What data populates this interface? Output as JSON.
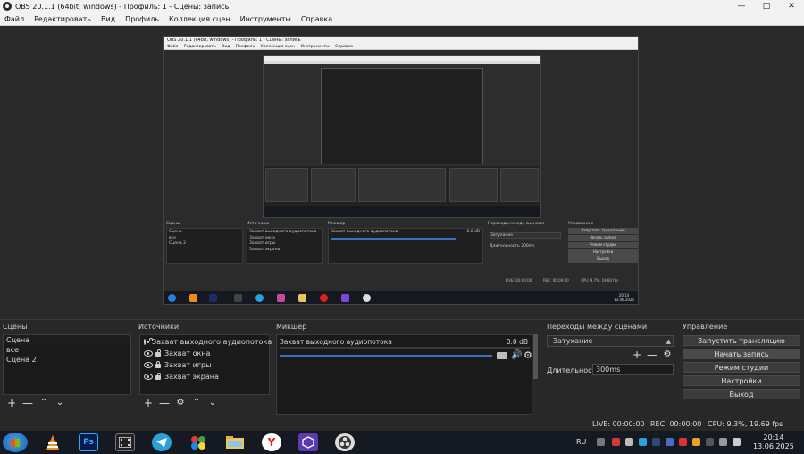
{
  "window": {
    "title": "OBS 20.1.1 (64bit, windows) - Профиль: 1 - Сцены: запись"
  },
  "menu": [
    "Файл",
    "Редактировать",
    "Вид",
    "Профиль",
    "Коллекция сцен",
    "Инструменты",
    "Справка"
  ],
  "scenes": {
    "title": "Сцены",
    "items": [
      "Сцена",
      "все",
      "Сцена 2"
    ]
  },
  "sources": {
    "title": "Источники",
    "items": [
      {
        "name": "Захват выходного аудиопотока",
        "visible": true,
        "locked": true
      },
      {
        "name": "Захват окна",
        "visible": true,
        "locked": false
      },
      {
        "name": "Захват игры",
        "visible": true,
        "locked": true
      },
      {
        "name": "Захват экрана",
        "visible": true,
        "locked": false
      }
    ]
  },
  "mixer": {
    "title": "Микшер",
    "channel": "Захват выходного аудиопотока",
    "level_db": "0.0 dB",
    "fader_level": 0.85
  },
  "transitions": {
    "title": "Переходы между сценами",
    "selected": "Затухание",
    "duration_label": "Длительность",
    "duration": "300ms"
  },
  "controls": {
    "title": "Управление",
    "buttons": [
      "Запустить трансляцию",
      "Начать запись",
      "Режим студии",
      "Настройки",
      "Выход"
    ]
  },
  "status": {
    "live": "LIVE: 00:00:00",
    "rec": "REC: 00:00:00",
    "cpu": "CPU: 9.3%, 19.69 fps"
  },
  "taskbar": {
    "lang": "RU",
    "time": "20:14",
    "date": "13.06.2025"
  },
  "preview_window": {
    "title": "OBS 20.1.1 (64bit, windows) - Профиль: 1 - Сцены: запись",
    "menu": [
      "Файл",
      "Редактировать",
      "Вид",
      "Профиль",
      "Коллекция сцен",
      "Инструменты",
      "Справка"
    ],
    "scenes_title": "Сцены",
    "sources_title": "Источники",
    "mixer_title": "Микшер",
    "transitions_title": "Переходы между сценами",
    "controls_title": "Управление",
    "scenes": [
      "Сцена",
      "все",
      "Сцена 2"
    ],
    "sources": [
      "Захват выходного аудиопотока",
      "Захват окна",
      "Захват игры",
      "Захват экрана"
    ],
    "mixer_channel": "Захват выходного аудиопотока",
    "mixer_db": "0.0 dB",
    "transition": "Затухание",
    "duration_label": "Длительность",
    "duration": "300ms",
    "buttons": [
      "Запустить трансляцию",
      "Начать запись",
      "Режим студии",
      "Настройки",
      "Выход"
    ],
    "live": "LIVE: 00:00:00",
    "rec": "REC: 00:00:00",
    "cpu": "CPU: 9.7%, 19.60 fps",
    "time": "20:14",
    "date": "13.06.2025"
  },
  "colors": {
    "accent": "#3a6fc6",
    "panel": "#1a1a1a",
    "background": "#282828"
  }
}
